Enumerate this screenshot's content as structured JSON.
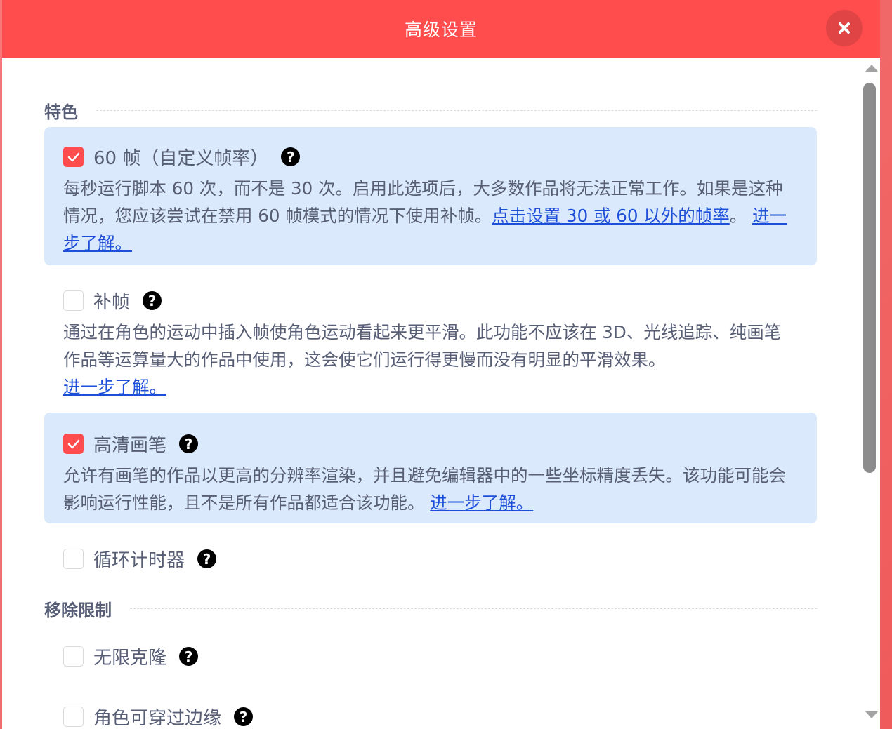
{
  "header": {
    "title": "高级设置",
    "close_icon": "close-icon"
  },
  "sections": [
    {
      "title": "特色"
    },
    {
      "title": "移除限制"
    }
  ],
  "options": [
    {
      "label": "60 帧（自定义帧率）",
      "checked": true,
      "desc": "每秒运行脚本 60 次，而不是 30 次。启用此选项后，大多数作品将无法正常工作。如果是这种情况，您应该尝试在禁用 60 帧模式的情况下使用补帧。",
      "link1": "点击设置 30 或 60 以外的帧率",
      "after_link1": "。",
      "learn_more": "进一步了解。"
    },
    {
      "label": "补帧",
      "checked": false,
      "desc": "通过在角色的运动中插入帧使角色运动看起来更平滑。此功能不应该在 3D、光线追踪、纯画笔作品等运算量大的作品中使用，这会使它们运行得更慢而没有明显的平滑效果。",
      "learn_more": "进一步了解。"
    },
    {
      "label": "高清画笔",
      "checked": true,
      "desc": "允许有画笔的作品以更高的分辨率渲染，并且避免编辑器中的一些坐标精度丢失。该功能可能会影响运行性能，且不是所有作品都适合该功能。",
      "learn_more": "进一步了解。"
    },
    {
      "label": "循环计时器",
      "checked": false
    },
    {
      "label": "无限克隆",
      "checked": false
    },
    {
      "label": "角色可穿过边缘",
      "checked": false
    }
  ],
  "help_glyph": "?",
  "colors": {
    "accent": "#ff4c4c",
    "highlight": "#dbe9fc",
    "text": "#575e75",
    "link": "#1d4fd8"
  }
}
